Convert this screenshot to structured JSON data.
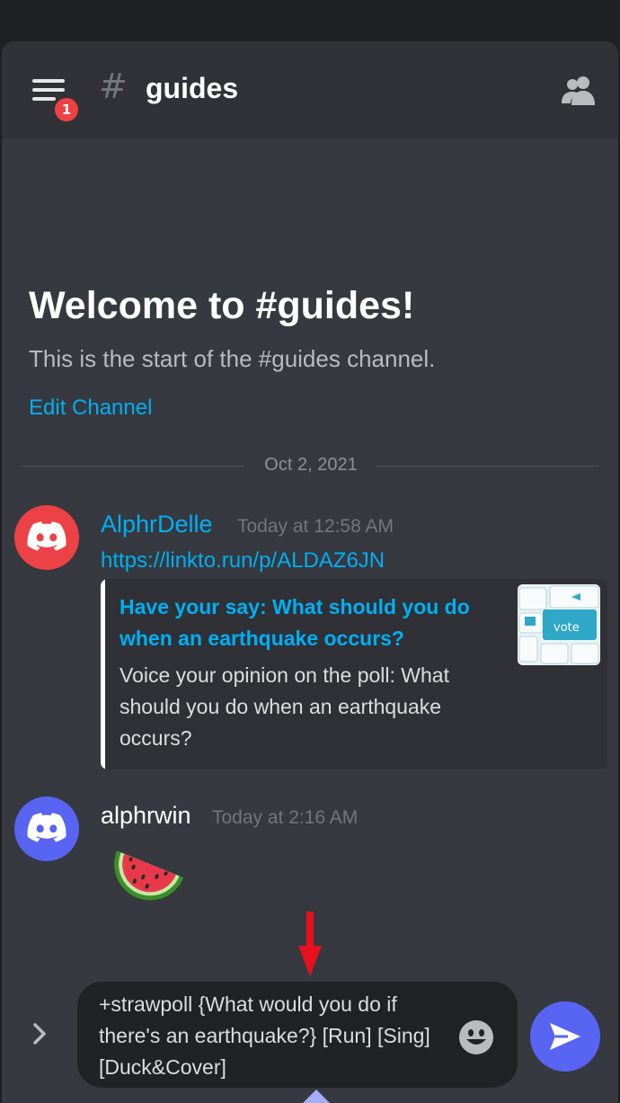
{
  "header": {
    "channel_symbol": "#",
    "channel_name": "guides",
    "notification_count": "1"
  },
  "welcome": {
    "title": "Welcome to #guides!",
    "subtitle": "This is the start of the #guides channel.",
    "edit_link": "Edit Channel"
  },
  "divider": {
    "date": "Oct 2, 2021"
  },
  "messages": [
    {
      "author": "AlphrDelle",
      "author_color": "#00aff4",
      "avatar_color": "#ed4245",
      "timestamp": "Today at 12:58 AM",
      "link": "https://linkto.run/p/ALDAZ6JN",
      "embed": {
        "title": "Have your say: What should you do when an earthquake occurs?",
        "description": "Voice your opinion on the poll:  What should you do when an earthquake occurs?",
        "thumbnail_label": "vote"
      }
    },
    {
      "author": "alphrwin",
      "author_color": "#ffffff",
      "avatar_color": "#5865f2",
      "timestamp": "Today at 2:16 AM",
      "content_emoji": "watermelon"
    }
  ],
  "composer": {
    "text": "+strawpoll {What would you do if there's an earthquake?} [Run] [Sing] [Duck&Cover]"
  },
  "icons": {
    "menu": "hamburger-menu-icon",
    "members": "members-icon",
    "emoji": "smiley-icon",
    "send": "send-arrow-icon",
    "expand": "chevron-right-icon"
  },
  "colors": {
    "background": "#36393f",
    "header": "#303237",
    "accent": "#5865f2",
    "link": "#00aff4",
    "badge": "#ed4245",
    "annotation_arrow": "#e8101e"
  }
}
